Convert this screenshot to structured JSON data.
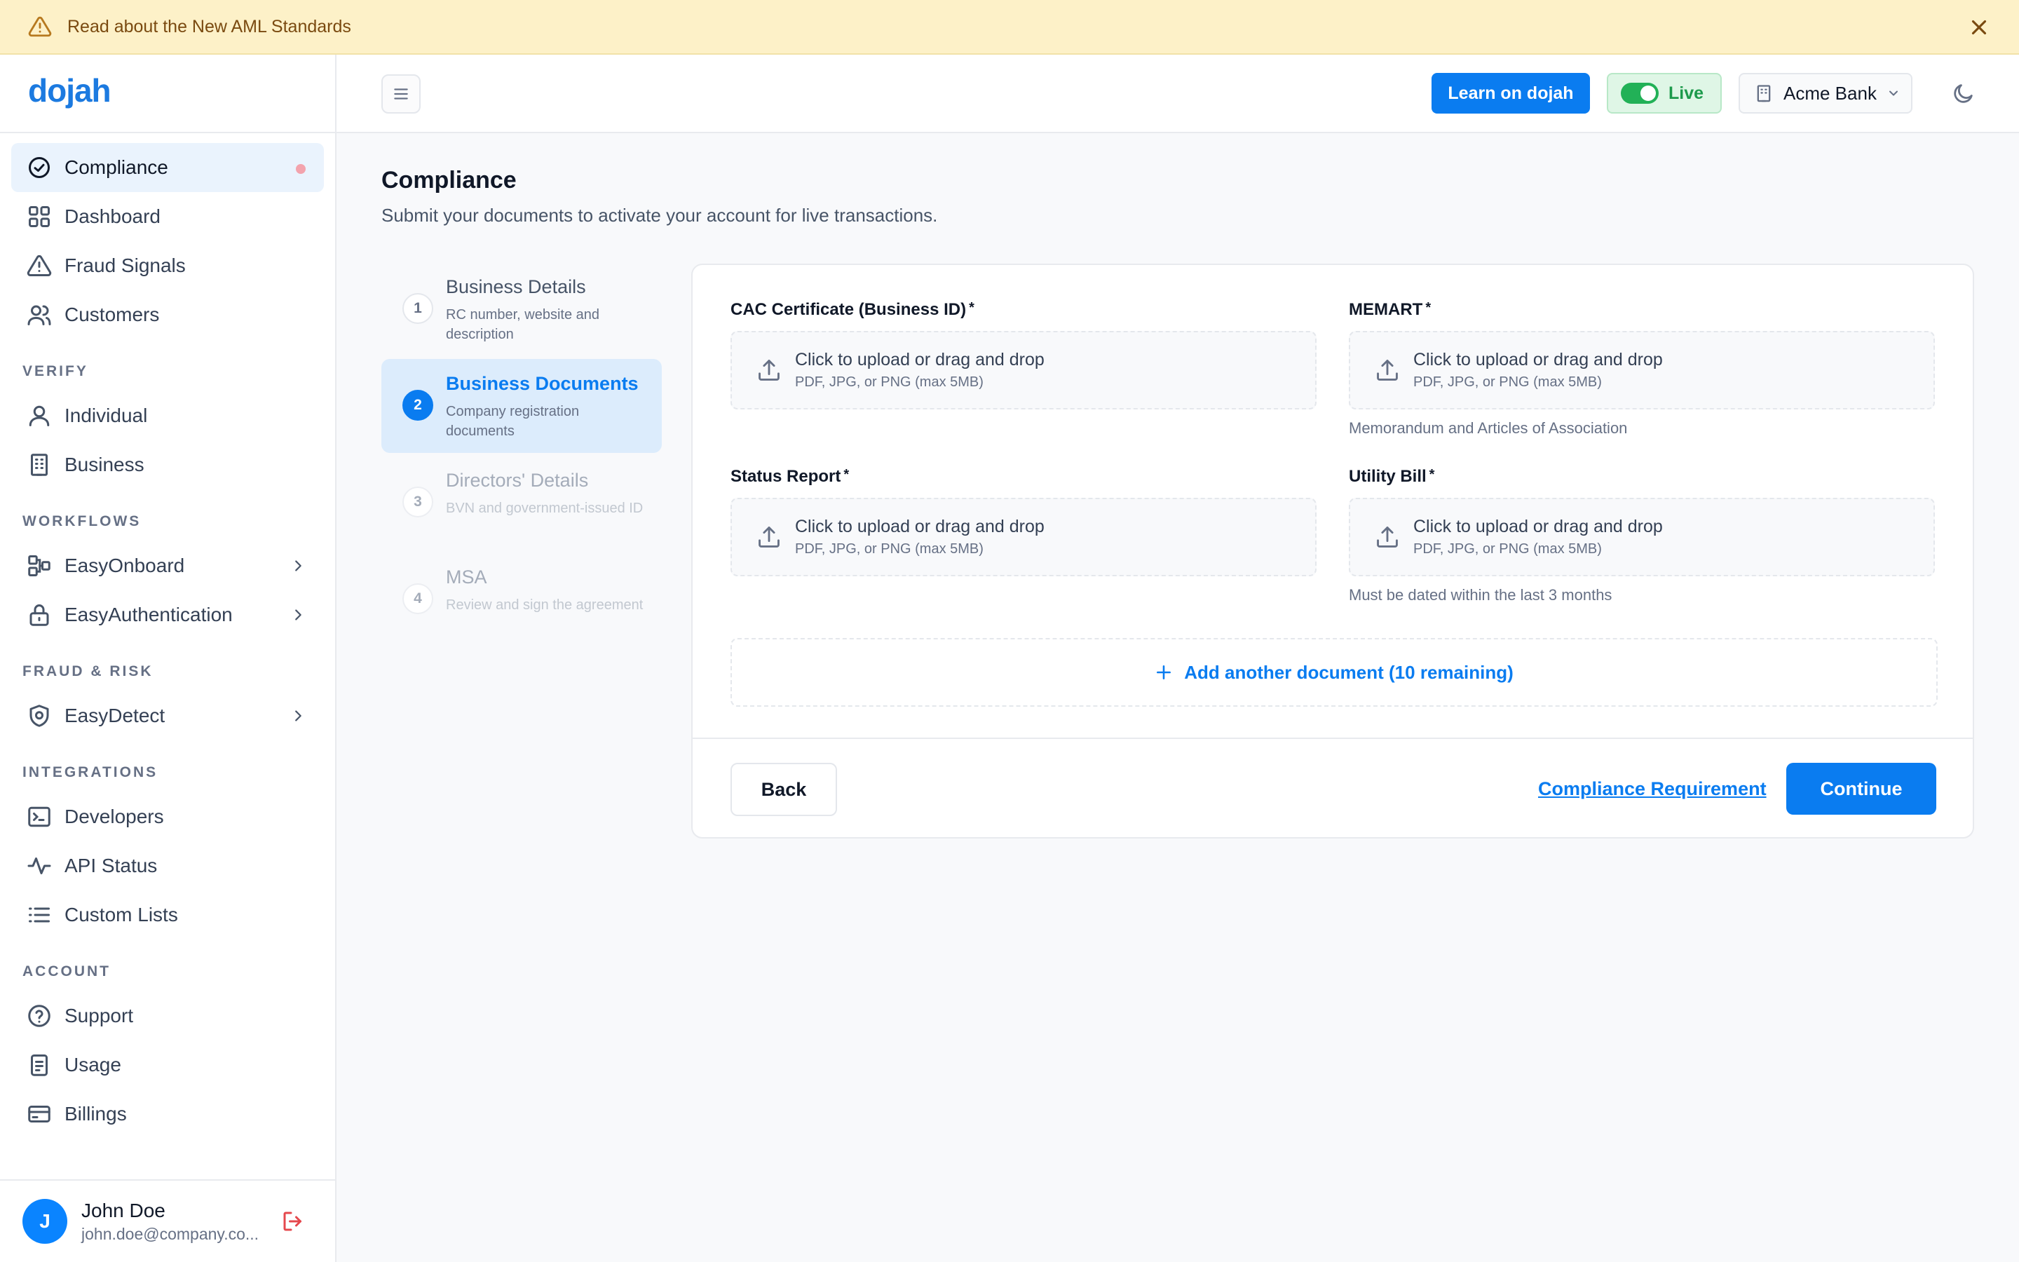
{
  "banner": {
    "text": "Read about the New AML Standards"
  },
  "brand": {
    "logo": "dojah",
    "accent": "#0a7cf0"
  },
  "sidebar": {
    "top_items": [
      {
        "label": "Compliance",
        "icon": "check-circle-icon"
      },
      {
        "label": "Dashboard",
        "icon": "grid-icon"
      },
      {
        "label": "Fraud Signals",
        "icon": "warning-icon"
      },
      {
        "label": "Customers",
        "icon": "users-icon"
      }
    ],
    "sections": {
      "verify": {
        "title": "VERIFY",
        "items": [
          {
            "label": "Individual"
          },
          {
            "label": "Business"
          }
        ]
      },
      "workflows": {
        "title": "WORKFLOWS",
        "items": [
          {
            "label": "EasyOnboard"
          },
          {
            "label": "EasyAuthentication"
          }
        ]
      },
      "fraud": {
        "title": "FRAUD & RISK",
        "items": [
          {
            "label": "EasyDetect"
          }
        ]
      },
      "integrations": {
        "title": "INTEGRATIONS",
        "items": [
          {
            "label": "Developers"
          },
          {
            "label": "API Status"
          },
          {
            "label": "Custom Lists"
          }
        ]
      },
      "account": {
        "title": "ACCOUNT",
        "items": [
          {
            "label": "Support"
          },
          {
            "label": "Usage"
          },
          {
            "label": "Billings"
          }
        ]
      }
    },
    "user": {
      "initial": "J",
      "name": "John Doe",
      "email": "john.doe@company.co..."
    }
  },
  "topbar": {
    "learn_label": "Learn on dojah",
    "live_label": "Live",
    "org_label": "Acme Bank"
  },
  "main": {
    "title": "Compliance",
    "subtitle": "Submit your documents to activate your account for live transactions.",
    "steps": [
      {
        "num": "1",
        "title": "Business Details",
        "desc": "RC number, website and description"
      },
      {
        "num": "2",
        "title": "Business Documents",
        "desc": "Company registration documents"
      },
      {
        "num": "3",
        "title": "Directors' Details",
        "desc": "BVN and government-issued ID"
      },
      {
        "num": "4",
        "title": "MSA",
        "desc": "Review and sign the agreement"
      }
    ],
    "fields": [
      {
        "label": "CAC Certificate (Business ID)",
        "req": "*",
        "help": ""
      },
      {
        "label": "MEMART",
        "req": "*",
        "help": "Memorandum and Articles of Association"
      },
      {
        "label": "Status Report",
        "req": "*",
        "help": ""
      },
      {
        "label": "Utility Bill",
        "req": "*",
        "help": "Must be dated within the last 3 months"
      }
    ],
    "upload_text": "Click to upload or drag and drop",
    "upload_hint": "PDF, JPG, or PNG (max 5MB)",
    "add_doc_label": "Add another document (10 remaining)",
    "back_label": "Back",
    "requirement_link": "Compliance Requirement",
    "continue_label": "Continue"
  }
}
